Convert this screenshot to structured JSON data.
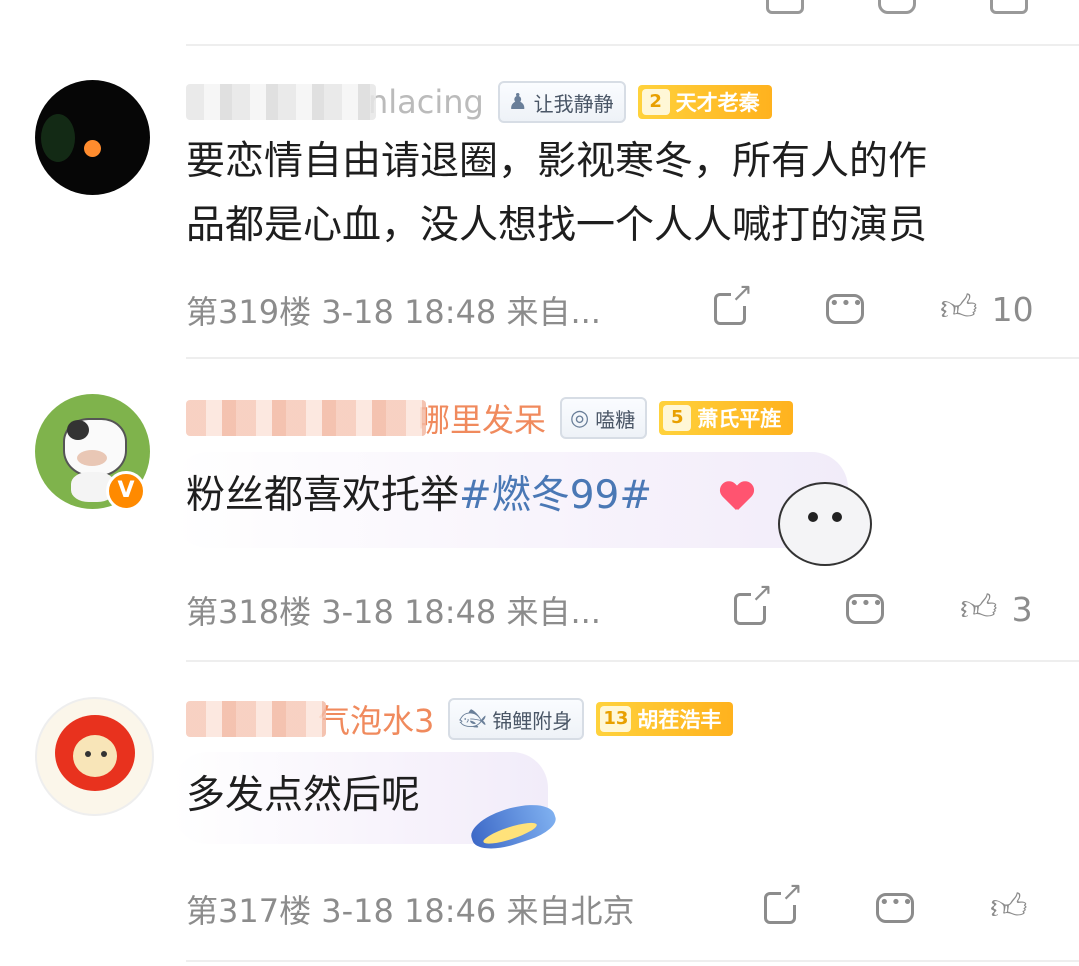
{
  "comments": [
    {
      "name_visible": "nlacing",
      "fan_badge": "让我静静",
      "rank_level": "2",
      "rank_label": "天才老秦",
      "text_lines": [
        "要恋情自由请退圈，影视寒冬，所有人的作",
        "品都是心血，没人想找一个人人喊打的演员"
      ],
      "floor": "第319楼",
      "time": "3-18 18:48",
      "source": "来自...",
      "likes": "10"
    },
    {
      "name_visible": "哪里发呆",
      "fan_badge": "嗑糖",
      "rank_level": "5",
      "rank_label": "萧氏平旌",
      "text": "粉丝都喜欢托举",
      "hashtag": "#燃冬99#",
      "verified_badge": "V",
      "floor": "第318楼",
      "time": "3-18 18:48",
      "source": "来自...",
      "likes": "3"
    },
    {
      "name_visible": "气泡水3",
      "fan_badge": "锦鲤附身",
      "rank_level": "13",
      "rank_label": "胡茬浩丰",
      "text": "多发点然后呢",
      "floor": "第317楼",
      "time": "3-18 18:46",
      "source": "来自北京",
      "likes": ""
    }
  ],
  "icons": {
    "share": "share-icon",
    "comment": "comment-icon",
    "like": "like-icon"
  },
  "colors": {
    "meta_text": "#8c8c8c",
    "hashtag": "#4a78b5",
    "rank_badge": "#ffb21e",
    "verified": "#ff8a00"
  }
}
